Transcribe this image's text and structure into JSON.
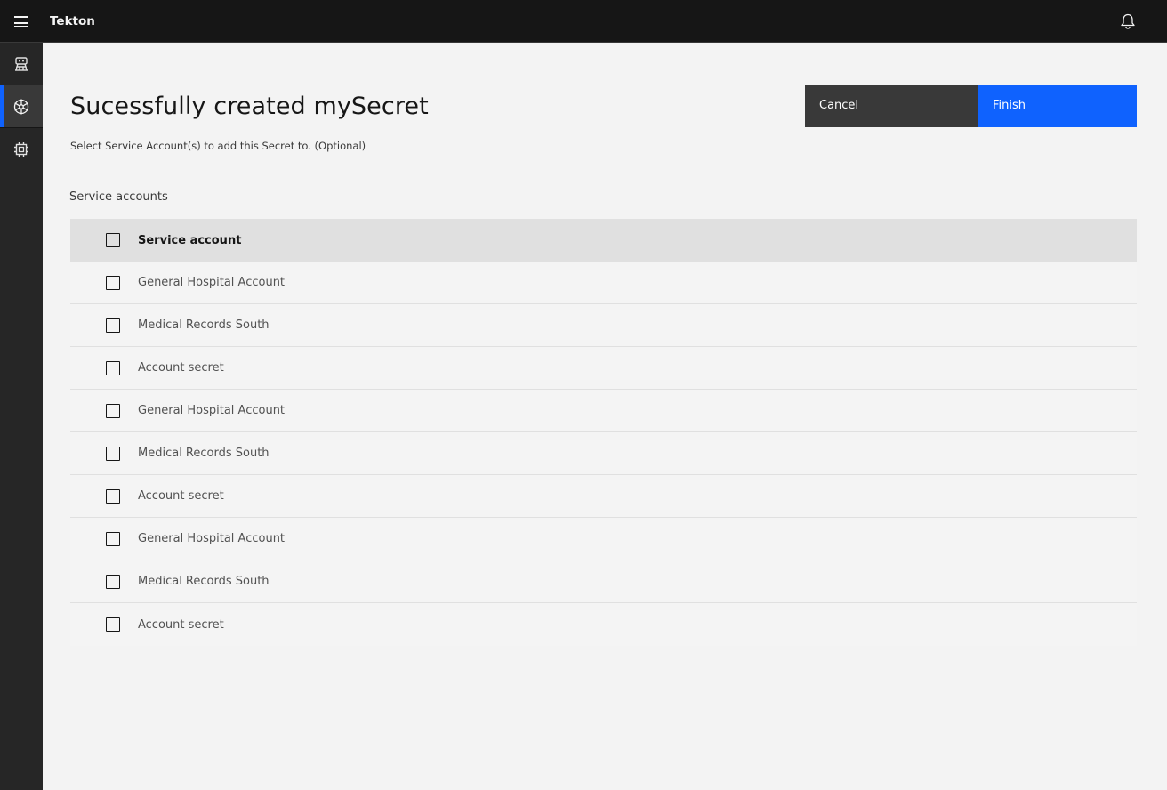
{
  "header": {
    "brand": "Tekton",
    "menu_icon": "hamburger-icon",
    "notification_icon": "bell-icon"
  },
  "sidenav": {
    "items": [
      {
        "icon": "tekton-robot-icon",
        "active": false
      },
      {
        "icon": "kubernetes-wheel-icon",
        "active": true
      },
      {
        "icon": "chip-icon",
        "active": false
      }
    ]
  },
  "page": {
    "title": "Sucessfully created mySecret",
    "subtitle": "Select Service Account(s) to add this Secret to. (Optional)"
  },
  "actions": {
    "cancel_label": "Cancel",
    "finish_label": "Finish"
  },
  "table": {
    "section_label": "Service accounts",
    "header": "Service account",
    "rows": [
      "General Hospital Account",
      "Medical Records South",
      "Account secret",
      "General Hospital Account",
      "Medical Records South",
      "Account secret",
      "General Hospital Account",
      "Medical Records South",
      "Account secret"
    ]
  },
  "colors": {
    "primary": "#0f62fe",
    "header_bg": "#161616",
    "sidenav_bg": "#262626",
    "page_bg": "#f3f3f3"
  }
}
